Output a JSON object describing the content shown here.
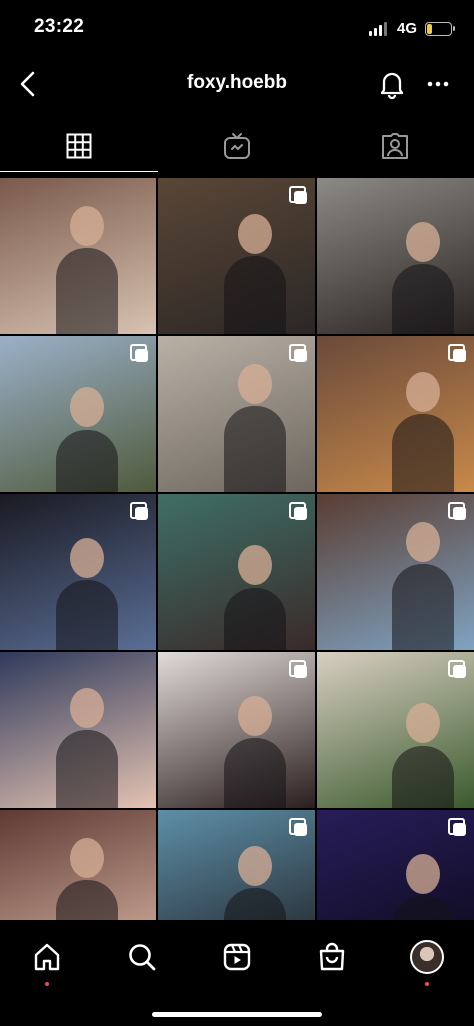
{
  "status_bar": {
    "time": "23:22",
    "network": "4G",
    "battery_level": 0.25
  },
  "header": {
    "username": "foxy.hoebb"
  },
  "tabs": [
    {
      "name": "grid-tab",
      "icon": "grid-icon",
      "active": true
    },
    {
      "name": "igtv-tab",
      "icon": "igtv-icon",
      "active": false
    },
    {
      "name": "tagged-tab",
      "icon": "tagged-icon",
      "active": false
    }
  ],
  "posts": [
    {
      "multiple": false,
      "colors": [
        "#7a5a4a",
        "#d8c2b2"
      ]
    },
    {
      "multiple": true,
      "colors": [
        "#5a4636",
        "#2b2726"
      ]
    },
    {
      "multiple": false,
      "colors": [
        "#8c8a85",
        "#2a2422"
      ]
    },
    {
      "multiple": true,
      "colors": [
        "#9bb0c8",
        "#4f5a3c"
      ]
    },
    {
      "multiple": true,
      "colors": [
        "#b9b1a6",
        "#6d665e"
      ]
    },
    {
      "multiple": true,
      "colors": [
        "#6a4a3a",
        "#c8894a"
      ]
    },
    {
      "multiple": true,
      "colors": [
        "#1a1a22",
        "#5a6e96"
      ]
    },
    {
      "multiple": true,
      "colors": [
        "#3e6f66",
        "#3a2a2a"
      ]
    },
    {
      "multiple": true,
      "colors": [
        "#5a3d32",
        "#7fa3c2"
      ]
    },
    {
      "multiple": false,
      "colors": [
        "#2f3a5c",
        "#e5c3b2"
      ]
    },
    {
      "multiple": true,
      "colors": [
        "#e2dbd8",
        "#2a1e1e"
      ]
    },
    {
      "multiple": true,
      "colors": [
        "#d8cfc2",
        "#3b5a2d"
      ]
    },
    {
      "multiple": false,
      "colors": [
        "#5e3a34",
        "#d6b3a2"
      ]
    },
    {
      "multiple": true,
      "colors": [
        "#5d8fa8",
        "#202025"
      ]
    },
    {
      "multiple": true,
      "colors": [
        "#281d5a",
        "#0b0a1a"
      ]
    }
  ],
  "bottom_nav": [
    {
      "name": "nav-home",
      "icon": "home-icon",
      "has_dot": true
    },
    {
      "name": "nav-search",
      "icon": "search-icon",
      "has_dot": false
    },
    {
      "name": "nav-reels",
      "icon": "reels-icon",
      "has_dot": false
    },
    {
      "name": "nav-shop",
      "icon": "shop-icon",
      "has_dot": false
    },
    {
      "name": "nav-profile",
      "icon": "avatar",
      "has_dot": true
    }
  ],
  "colors": {
    "background": "#000000",
    "text": "#ffffff",
    "notification_dot": "#ed4956",
    "battery": "#f5c842"
  }
}
